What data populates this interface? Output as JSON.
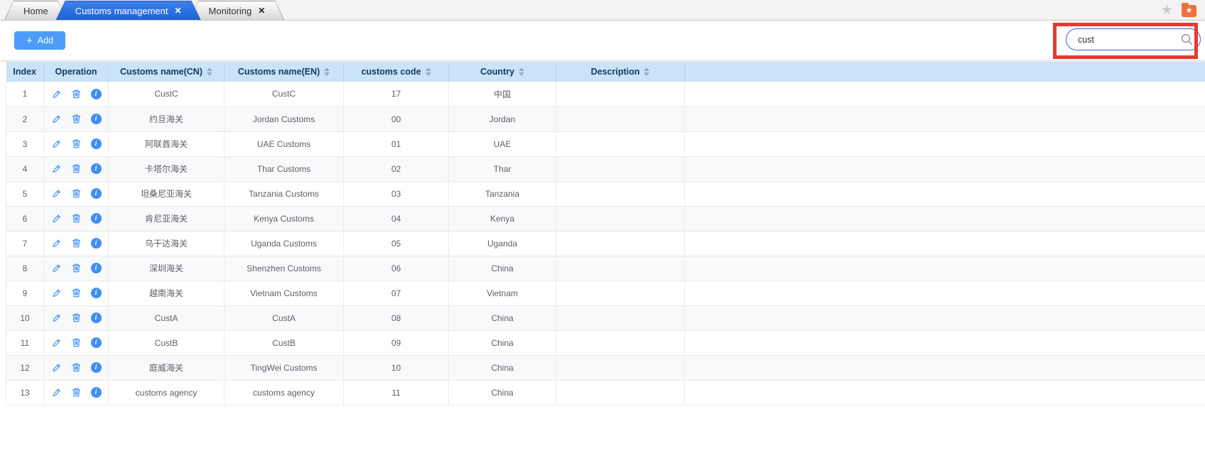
{
  "tab_bar": {
    "tabs": [
      {
        "label": "Home",
        "active": false,
        "closable": false
      },
      {
        "label": "Customs management",
        "active": true,
        "closable": true
      },
      {
        "label": "Monitoring",
        "active": false,
        "closable": true
      }
    ]
  },
  "icons": {
    "close_glyph": "✕",
    "plus_glyph": "+",
    "star_glyph": "★",
    "folder_star_glyph": "★",
    "info_glyph": "i"
  },
  "toolbar": {
    "add_button": {
      "label": "Add"
    },
    "search": {
      "value": "cust",
      "placeholder": "",
      "highlighted": true
    }
  },
  "annotation": {
    "type": "red-highlight-box",
    "color": "#e63a30"
  },
  "colors": {
    "accent_blue": "#3e8ef7",
    "active_tab": "#1e62d6",
    "header_bg": "#cbe3f8",
    "header_text": "#123a63",
    "add_button": "#4d9cfa",
    "favorites_folder": "#f0703c"
  },
  "table": {
    "columns": [
      {
        "key": "index",
        "label": "Index",
        "sortable": false
      },
      {
        "key": "operation",
        "label": "Operation",
        "sortable": false
      },
      {
        "key": "cn",
        "label": "Customs name(CN)",
        "sortable": true
      },
      {
        "key": "en",
        "label": "Customs name(EN)",
        "sortable": true
      },
      {
        "key": "code",
        "label": "customs code",
        "sortable": true
      },
      {
        "key": "country",
        "label": "Country",
        "sortable": true
      },
      {
        "key": "description",
        "label": "Description",
        "sortable": true
      }
    ],
    "operation_icons": [
      "edit",
      "delete",
      "info"
    ],
    "rows": [
      {
        "index": "1",
        "cn": "CustC",
        "en": "CustC",
        "code": "17",
        "country": "中国",
        "description": ""
      },
      {
        "index": "2",
        "cn": "约旦海关",
        "en": "Jordan Customs",
        "code": "00",
        "country": "Jordan",
        "description": ""
      },
      {
        "index": "3",
        "cn": "阿联酋海关",
        "en": "UAE Customs",
        "code": "01",
        "country": "UAE",
        "description": ""
      },
      {
        "index": "4",
        "cn": "卡塔尔海关",
        "en": "Thar Customs",
        "code": "02",
        "country": "Thar",
        "description": ""
      },
      {
        "index": "5",
        "cn": "坦桑尼亚海关",
        "en": "Tanzania Customs",
        "code": "03",
        "country": "Tanzania",
        "description": ""
      },
      {
        "index": "6",
        "cn": "肯尼亚海关",
        "en": "Kenya Customs",
        "code": "04",
        "country": "Kenya",
        "description": ""
      },
      {
        "index": "7",
        "cn": "乌干达海关",
        "en": "Uganda Customs",
        "code": "05",
        "country": "Uganda",
        "description": ""
      },
      {
        "index": "8",
        "cn": "深圳海关",
        "en": "Shenzhen Customs",
        "code": "06",
        "country": "China",
        "description": ""
      },
      {
        "index": "9",
        "cn": "越南海关",
        "en": "Vietnam Customs",
        "code": "07",
        "country": "Vietnam",
        "description": ""
      },
      {
        "index": "10",
        "cn": "CustA",
        "en": "CustA",
        "code": "08",
        "country": "China",
        "description": ""
      },
      {
        "index": "11",
        "cn": "CustB",
        "en": "CustB",
        "code": "09",
        "country": "China",
        "description": ""
      },
      {
        "index": "12",
        "cn": "庭威海关",
        "en": "TingWei Customs",
        "code": "10",
        "country": "China",
        "description": ""
      },
      {
        "index": "13",
        "cn": "customs agency",
        "en": "customs agency",
        "code": "11",
        "country": "China",
        "description": ""
      }
    ]
  }
}
